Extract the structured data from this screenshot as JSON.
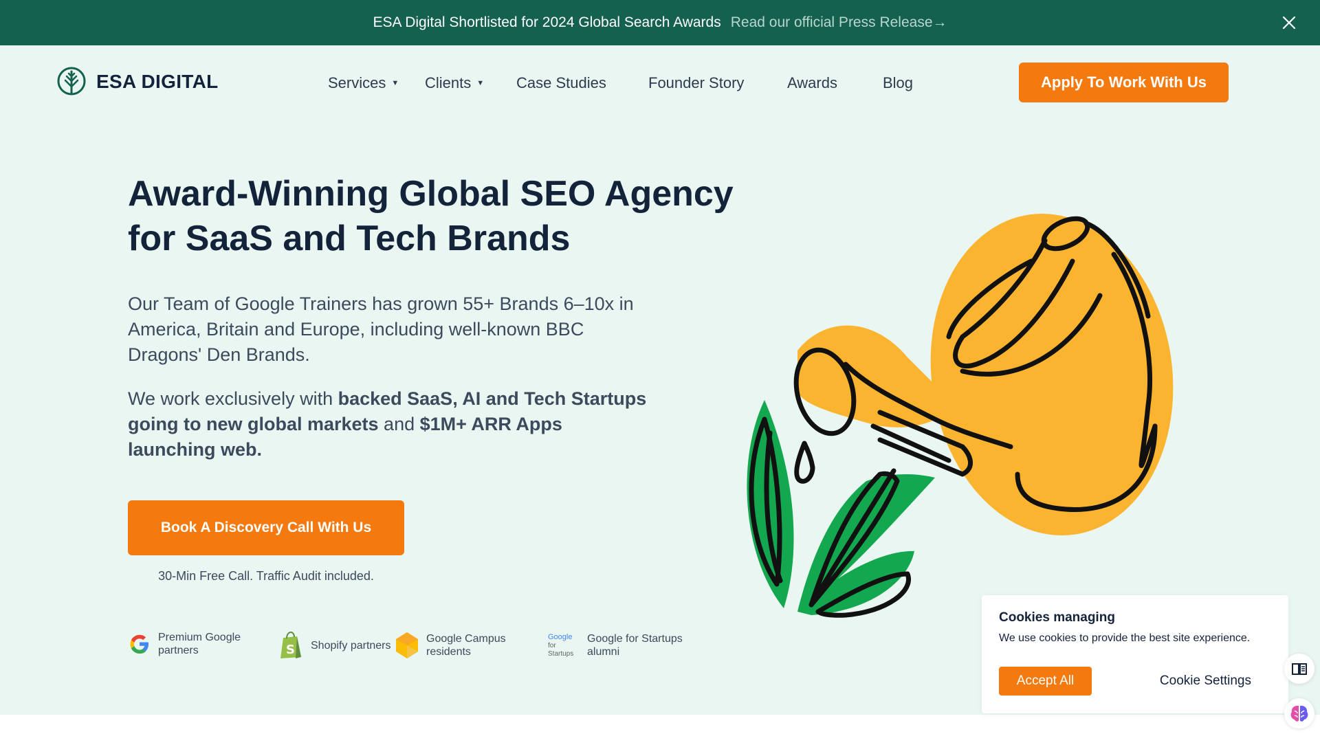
{
  "announcement": {
    "text": "ESA Digital Shortlisted for 2024 Global Search Awards",
    "link_text": "Read our official Press Release→",
    "close_icon": "close-icon"
  },
  "header": {
    "logo_text": "ESA DIGITAL",
    "nav": [
      {
        "label": "Services",
        "has_dropdown": true
      },
      {
        "label": "Clients",
        "has_dropdown": true
      },
      {
        "label": "Case Studies",
        "has_dropdown": false
      },
      {
        "label": "Founder Story",
        "has_dropdown": false
      },
      {
        "label": "Awards",
        "has_dropdown": false
      },
      {
        "label": "Blog",
        "has_dropdown": false
      }
    ],
    "cta_label": "Apply To Work With Us"
  },
  "hero": {
    "title_line1": "Award-Winning Global SEO Agency",
    "title_line2": "for SaaS and Tech Brands",
    "para1": "Our Team of Google Trainers has grown 55+ Brands 6–10x in America, Britain and Europe, including well-known BBC Dragons' Den Brands.",
    "para2": {
      "t1": "We work exclusively with ",
      "b1": "backed SaaS, AI and Tech Startups going to new global markets",
      "t2": " and ",
      "b2": "$1M+ ARR Apps launching web."
    },
    "cta_label": "Book A Discovery Call With Us",
    "cta_note": "30-Min Free Call. Traffic Audit included."
  },
  "badges": [
    {
      "icon": "google-g-icon",
      "label": "Premium Google partners"
    },
    {
      "icon": "shopify-bag-icon",
      "label": "Shopify partners"
    },
    {
      "icon": "google-campus-icon",
      "label": "Google Campus residents"
    },
    {
      "icon": "google-for-startups-icon",
      "logo_text": [
        "Google",
        "for",
        "Startups"
      ],
      "label": "Google for Startups alumni"
    }
  ],
  "cookie": {
    "title": "Cookies managing",
    "text": "We use cookies to provide the best site experience.",
    "accept_label": "Accept All",
    "settings_label": "Cookie Settings"
  },
  "colors": {
    "brand_green": "#15614f",
    "accent_orange": "#f4790f",
    "background": "#eaf6f1",
    "illustration_yellow": "#fbb430",
    "illustration_green": "#13a84f"
  }
}
